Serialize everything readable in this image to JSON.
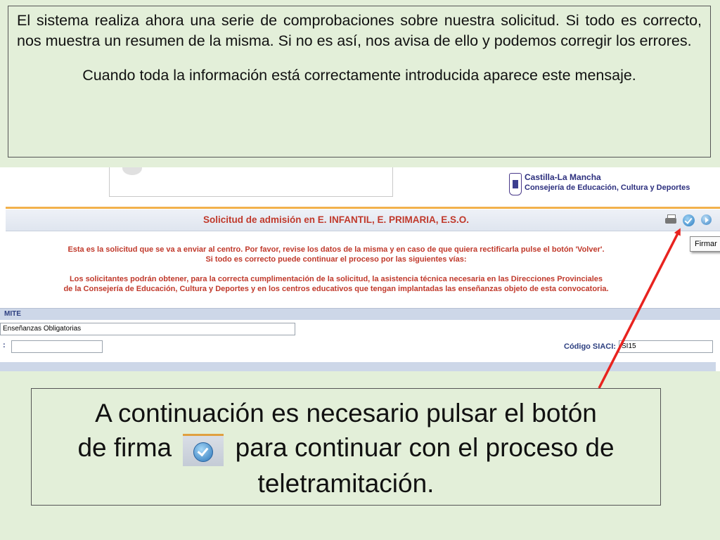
{
  "top_note": {
    "paragraph1": "El sistema realiza ahora una serie de comprobaciones sobre nuestra solicitud. Si todo es correcto, nos muestra un resumen de la misma. Si no es así, nos avisa de ello y podemos corregir los errores.",
    "paragraph2": "Cuando toda la información está correctamente introducida aparece este mensaje."
  },
  "screenshot": {
    "logo_line1": "Castilla-La Mancha",
    "logo_line2": "Consejería de Educación, Cultura y Deportes",
    "title": "Solicitud de admisión en E. INFANTIL, E. PRIMARIA, E.S.O.",
    "toolbar": {
      "print_icon": "printer-icon",
      "sign_icon": "sign-check-icon",
      "back_icon": "forward-arrow-icon"
    },
    "tooltip": "Firmar",
    "info_line1": "Esta es la solicitud que se va a enviar al centro. Por favor, revise los datos de la misma y en caso de que quiera rectificarla pulse el botón 'Volver'.",
    "info_line2": "Si todo es correcto puede continuar el proceso por las siguientes vías:",
    "info_line3": "Los solicitantes podrán obtener, para la correcta cumplimentación de la solicitud, la asistencia técnica necesaria en las Direcciones Provinciales",
    "info_line4": "de la Consejería de Educación, Cultura y Deportes y en los centros educativos que tengan implantadas las enseñanzas objeto de esta convocatoria.",
    "section_label": "MITE",
    "field1_value": "Enseñanzas Obligatorias",
    "field2_label": ":",
    "field2_value": "",
    "siaci_label": "Código SIACI:",
    "siaci_value": "SI15"
  },
  "bottom_note": {
    "line1": "A continuación es necesario pulsar el botón",
    "line2_before": "de firma",
    "line2_after": "para continuar con el proceso de",
    "line3": "teletramitación."
  },
  "colors": {
    "background": "#e3efd9",
    "arrow": "#e8231f",
    "title_red": "#c0392b",
    "accent_orange": "#f2b14c"
  }
}
